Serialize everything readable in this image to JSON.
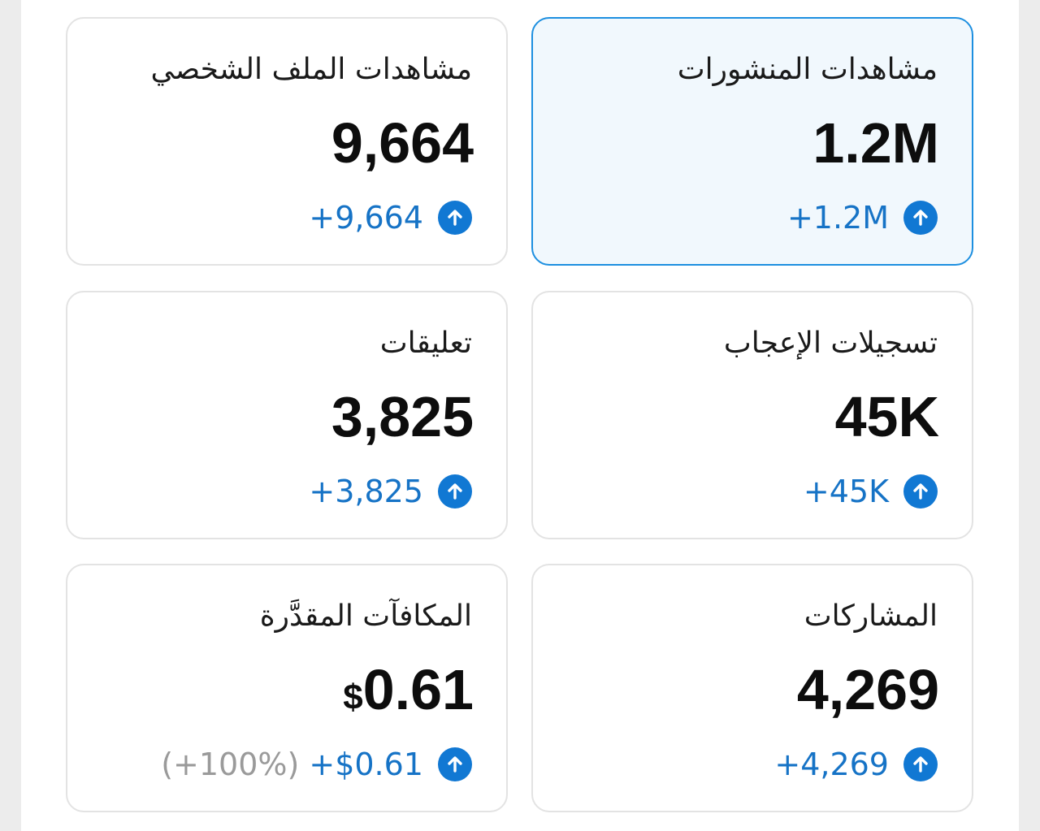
{
  "cards": [
    {
      "title": "مشاهدات المنشورات",
      "value": "1.2M",
      "change": "+1.2M",
      "selected": true
    },
    {
      "title": "مشاهدات الملف الشخصي",
      "value": "9,664",
      "change": "+9,664"
    },
    {
      "title": "تسجيلات الإعجاب",
      "value": "45K",
      "change": "+45K"
    },
    {
      "title": "تعليقات",
      "value": "3,825",
      "change": "+3,825"
    },
    {
      "title": "المشاركات",
      "value": "4,269",
      "change": "+4,269"
    },
    {
      "title": "المكافآت المقدَّرة",
      "currency": "$",
      "value": "0.61",
      "change": "+$0.61",
      "change_extra": "(+100%)"
    }
  ],
  "colors": {
    "accent": "#1178d3",
    "selected_border": "#1d8fe0",
    "selected_background": "#f1f8fd",
    "muted_text": "#9a9a9a"
  },
  "icons": {
    "change": "arrow-up-circle-icon"
  }
}
